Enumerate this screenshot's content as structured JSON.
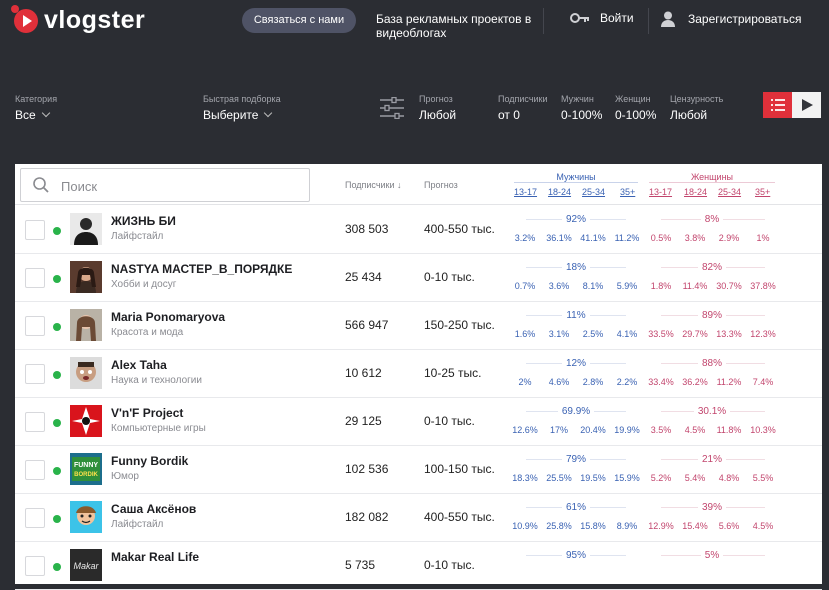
{
  "header": {
    "logo_text": "vlogster",
    "contact_button": "Связаться с нами",
    "base_text": "База рекламных проектов в видеоблогах",
    "login_label": "Войти",
    "register_label": "Зарегистрироваться",
    "icons": {
      "logo": "play-logo-icon",
      "login": "key-icon",
      "register": "user-icon"
    }
  },
  "filters": {
    "category": {
      "label": "Категория",
      "value": "Все"
    },
    "quick_pick": {
      "label": "Быстрая подборка",
      "value": "Выберите"
    },
    "forecast": {
      "label": "Прогноз",
      "value": "Любой"
    },
    "subscribers": {
      "label": "Подписчики",
      "value": "от 0"
    },
    "men": {
      "label": "Мужчин",
      "value": "0-100%"
    },
    "women": {
      "label": "Женщин",
      "value": "0-100%"
    },
    "censorship": {
      "label": "Цензурность",
      "value": "Любой"
    }
  },
  "table": {
    "search_placeholder": "Поиск",
    "col_subscribers": "Подписчики ↓",
    "col_forecast": "Прогноз",
    "men_group": "Мужчины",
    "women_group": "Женщины",
    "men_ages": [
      "13-17",
      "18-24",
      "25-34",
      "35+"
    ],
    "women_ages": [
      "13-17",
      "18-24",
      "25-34",
      "35+"
    ],
    "rows": [
      {
        "name": "ЖИЗНЬ БИ",
        "category": "Лайфстайл",
        "subscribers": "308 503",
        "forecast": "400-550 тыс.",
        "men_total": "92%",
        "men": [
          "3.2%",
          "36.1%",
          "41.1%",
          "11.2%"
        ],
        "women_total": "8%",
        "women": [
          "0.5%",
          "3.8%",
          "2.9%",
          "1%"
        ]
      },
      {
        "name": "NASTYA МАСТЕР_В_ПОРЯДКЕ",
        "category": "Хобби и досуг",
        "subscribers": "25 434",
        "forecast": "0-10 тыс.",
        "men_total": "18%",
        "men": [
          "0.7%",
          "3.6%",
          "8.1%",
          "5.9%"
        ],
        "women_total": "82%",
        "women": [
          "1.8%",
          "11.4%",
          "30.7%",
          "37.8%"
        ]
      },
      {
        "name": "Maria Ponomaryova",
        "category": "Красота и мода",
        "subscribers": "566 947",
        "forecast": "150-250 тыс.",
        "men_total": "11%",
        "men": [
          "1.6%",
          "3.1%",
          "2.5%",
          "4.1%"
        ],
        "women_total": "89%",
        "women": [
          "33.5%",
          "29.7%",
          "13.3%",
          "12.3%"
        ]
      },
      {
        "name": "Alex Taha",
        "category": "Наука и технологии",
        "subscribers": "10 612",
        "forecast": "10-25 тыс.",
        "men_total": "12%",
        "men": [
          "2%",
          "4.6%",
          "2.8%",
          "2.2%"
        ],
        "women_total": "88%",
        "women": [
          "33.4%",
          "36.2%",
          "11.2%",
          "7.4%"
        ]
      },
      {
        "name": "V'n'F Project",
        "category": "Компьютерные игры",
        "subscribers": "29 125",
        "forecast": "0-10 тыс.",
        "men_total": "69.9%",
        "men": [
          "12.6%",
          "17%",
          "20.4%",
          "19.9%"
        ],
        "women_total": "30.1%",
        "women": [
          "3.5%",
          "4.5%",
          "11.8%",
          "10.3%"
        ]
      },
      {
        "name": "Funny Bordik",
        "category": "Юмор",
        "subscribers": "102 536",
        "forecast": "100-150 тыс.",
        "men_total": "79%",
        "men": [
          "18.3%",
          "25.5%",
          "19.5%",
          "15.9%"
        ],
        "women_total": "21%",
        "women": [
          "5.2%",
          "5.4%",
          "4.8%",
          "5.5%"
        ]
      },
      {
        "name": "Саша Аксёнов",
        "category": "Лайфстайл",
        "subscribers": "182 082",
        "forecast": "400-550 тыс.",
        "men_total": "61%",
        "men": [
          "10.9%",
          "25.8%",
          "15.8%",
          "8.9%"
        ],
        "women_total": "39%",
        "women": [
          "12.9%",
          "15.4%",
          "5.6%",
          "4.5%"
        ]
      },
      {
        "name": "Makar Real Life",
        "category": "",
        "subscribers": "5 735",
        "forecast": "0-10 тыс.",
        "men_total": "95%",
        "men": [
          "",
          "",
          "",
          ""
        ],
        "women_total": "5%",
        "women": [
          "",
          "",
          "",
          ""
        ]
      }
    ]
  },
  "avatar_texts": {
    "funny": "FUNNY",
    "bordik": "BORDIK",
    "makar": "Makar"
  },
  "colors": {
    "accent": "#e0303a",
    "men": "#3a62b3",
    "women": "#c2456d",
    "online": "#29b34a",
    "bg": "#2b2d33"
  }
}
